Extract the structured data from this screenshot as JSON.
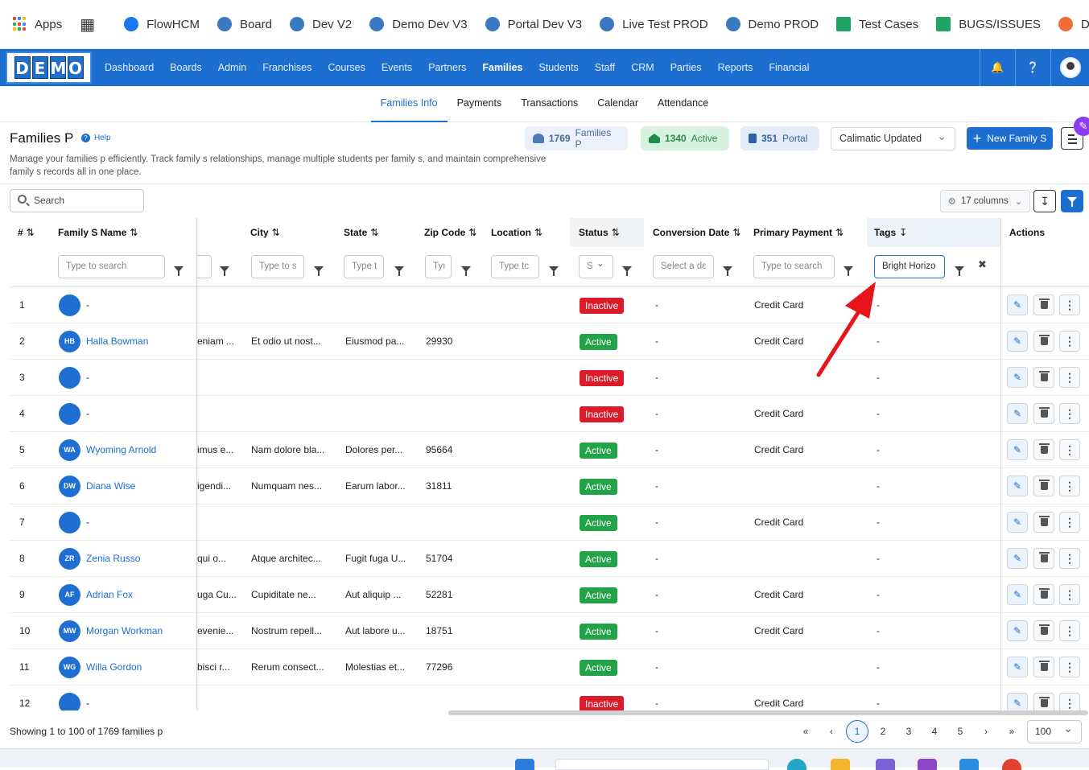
{
  "bookmarks": {
    "apps_label": "Apps",
    "items": [
      {
        "label": "FlowHCM",
        "color": "#1877f2"
      },
      {
        "label": "Board",
        "color": "#3a78c2"
      },
      {
        "label": "Dev V2",
        "color": "#3a78c2"
      },
      {
        "label": "Demo Dev V3",
        "color": "#3a78c2"
      },
      {
        "label": "Portal Dev V3",
        "color": "#3a78c2"
      },
      {
        "label": "Live Test PROD",
        "color": "#3a78c2"
      },
      {
        "label": "Demo PROD",
        "color": "#3a78c2"
      },
      {
        "label": "Test Cases",
        "color": "#1fa463"
      },
      {
        "label": "BUGS/ISSUES",
        "color": "#1fa463"
      },
      {
        "label": "Devenv - C",
        "color": "#ef6c33"
      }
    ]
  },
  "navbar": {
    "logo_letters": [
      "D",
      "E",
      "M",
      "O"
    ],
    "items": [
      {
        "label": "Dashboard",
        "active": false
      },
      {
        "label": "Boards",
        "active": false
      },
      {
        "label": "Admin",
        "active": false
      },
      {
        "label": "Franchises",
        "active": false
      },
      {
        "label": "Courses",
        "active": false
      },
      {
        "label": "Events",
        "active": false
      },
      {
        "label": "Partners",
        "active": false
      },
      {
        "label": "Families",
        "active": true
      },
      {
        "label": "Students",
        "active": false
      },
      {
        "label": "Staff",
        "active": false
      },
      {
        "label": "CRM",
        "active": false
      },
      {
        "label": "Parties",
        "active": false
      },
      {
        "label": "Reports",
        "active": false
      },
      {
        "label": "Financial",
        "active": false
      }
    ],
    "accent": "#1c6fd1"
  },
  "subtabs": [
    {
      "label": "Families Info",
      "active": true
    },
    {
      "label": "Payments",
      "active": false
    },
    {
      "label": "Transactions",
      "active": false
    },
    {
      "label": "Calendar",
      "active": false
    },
    {
      "label": "Attendance",
      "active": false
    }
  ],
  "page": {
    "title": "Families P",
    "help": "Help",
    "description": "Manage your families p efficiently. Track family s relationships, manage multiple students per family s, and maintain comprehensive family s records all in one place."
  },
  "stats": {
    "total_count": "1769",
    "total_label": "Families P",
    "active_count": "1340",
    "active_label": "Active",
    "portal_count": "351",
    "portal_label": "Portal"
  },
  "toolbar": {
    "view_select": "Calimatic Updated",
    "new_button": "New Family S",
    "search_placeholder": "Search",
    "columns_button": "17 columns"
  },
  "table": {
    "headers": {
      "num": "#",
      "name": "Family S Name",
      "city": "City",
      "state": "State",
      "zip": "Zip Code",
      "location": "Location",
      "status": "Status",
      "conversion": "Conversion Date",
      "payment": "Primary Payment",
      "tags": "Tags",
      "actions": "Actions"
    },
    "filters": {
      "name": "Type to search",
      "prev": "",
      "city": "Type to s",
      "state": "Type t",
      "zip": "Tyı",
      "location": "Type tc",
      "status": "S",
      "conversion": "Select a dε",
      "payment": "Type to search",
      "tags": "Bright Horizo"
    },
    "rows": [
      {
        "num": "1",
        "initials": "",
        "name": "-",
        "prev": "",
        "city": "",
        "state": "",
        "zip": "",
        "status": "Inactive",
        "conversion": "-",
        "payment": "Credit Card",
        "tags": "-"
      },
      {
        "num": "2",
        "initials": "HB",
        "name": "Halla Bowman",
        "prev": "eniam ...",
        "city": "Et odio ut nost...",
        "state": "Eiusmod pa...",
        "zip": "29930",
        "status": "Active",
        "conversion": "-",
        "payment": "Credit Card",
        "tags": "-"
      },
      {
        "num": "3",
        "initials": "",
        "name": "-",
        "prev": "",
        "city": "",
        "state": "",
        "zip": "",
        "status": "Inactive",
        "conversion": "-",
        "payment": "",
        "tags": "-"
      },
      {
        "num": "4",
        "initials": "",
        "name": "-",
        "prev": "",
        "city": "",
        "state": "",
        "zip": "",
        "status": "Inactive",
        "conversion": "-",
        "payment": "Credit Card",
        "tags": "-"
      },
      {
        "num": "5",
        "initials": "WA",
        "name": "Wyoming Arnold",
        "prev": "imus e...",
        "city": "Nam dolore bla...",
        "state": "Dolores per...",
        "zip": "95664",
        "status": "Active",
        "conversion": "-",
        "payment": "Credit Card",
        "tags": "-"
      },
      {
        "num": "6",
        "initials": "DW",
        "name": "Diana Wise",
        "prev": "igendi...",
        "city": "Numquam nes...",
        "state": "Earum labor...",
        "zip": "31811",
        "status": "Active",
        "conversion": "-",
        "payment": "",
        "tags": "-"
      },
      {
        "num": "7",
        "initials": "",
        "name": "-",
        "prev": "",
        "city": "",
        "state": "",
        "zip": "",
        "status": "Active",
        "conversion": "-",
        "payment": "Credit Card",
        "tags": "-"
      },
      {
        "num": "8",
        "initials": "ZR",
        "name": "Zenia Russo",
        "prev": "qui o...",
        "city": "Atque architec...",
        "state": "Fugit fuga U...",
        "zip": "51704",
        "status": "Active",
        "conversion": "-",
        "payment": "",
        "tags": "-"
      },
      {
        "num": "9",
        "initials": "AF",
        "name": "Adrian Fox",
        "prev": "uga Cu...",
        "city": "Cupiditate ne...",
        "state": "Aut aliquip ...",
        "zip": "52281",
        "status": "Active",
        "conversion": "-",
        "payment": "Credit Card",
        "tags": "-"
      },
      {
        "num": "10",
        "initials": "MW",
        "name": "Morgan Workman",
        "prev": "evenie...",
        "city": "Nostrum repell...",
        "state": "Aut labore u...",
        "zip": "18751",
        "status": "Active",
        "conversion": "-",
        "payment": "Credit Card",
        "tags": "-"
      },
      {
        "num": "11",
        "initials": "WG",
        "name": "Willa Gordon",
        "prev": "bisci r...",
        "city": "Rerum consect...",
        "state": "Molestias et...",
        "zip": "77296",
        "status": "Active",
        "conversion": "-",
        "payment": "",
        "tags": "-"
      },
      {
        "num": "12",
        "initials": "",
        "name": "-",
        "prev": "",
        "city": "",
        "state": "",
        "zip": "",
        "status": "Inactive",
        "conversion": "-",
        "payment": "Credit Card",
        "tags": "-"
      }
    ]
  },
  "footer": {
    "showing": "Showing 1 to 100 of 1769 families p",
    "pages": [
      "1",
      "2",
      "3",
      "4",
      "5"
    ],
    "current_page": "1",
    "per_page": "100"
  },
  "colors": {
    "active": "#22a347",
    "inactive": "#dc1b2a",
    "annotation_arrow": "#e8141c"
  }
}
